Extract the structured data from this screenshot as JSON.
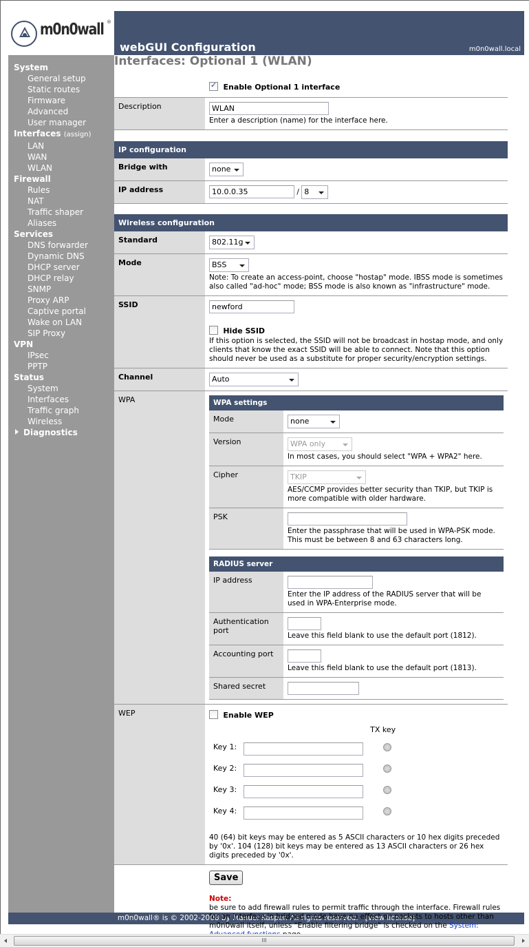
{
  "brand": {
    "logo_text": "m0n0wall",
    "registered": "®"
  },
  "header": {
    "title": "webGUI Configuration",
    "hostname": "m0n0wall.local"
  },
  "sidebar": {
    "groups": [
      {
        "label": "System",
        "items": [
          "General setup",
          "Static routes",
          "Firmware",
          "Advanced",
          "User manager"
        ]
      },
      {
        "label": "Interfaces",
        "extra": "(assign)",
        "items": [
          "LAN",
          "WAN",
          "WLAN"
        ]
      },
      {
        "label": "Firewall",
        "items": [
          "Rules",
          "NAT",
          "Traffic shaper",
          "Aliases"
        ]
      },
      {
        "label": "Services",
        "items": [
          "DNS forwarder",
          "Dynamic DNS",
          "DHCP server",
          "DHCP relay",
          "SNMP",
          "Proxy ARP",
          "Captive portal",
          "Wake on LAN",
          "SIP Proxy"
        ]
      },
      {
        "label": "VPN",
        "items": [
          "IPsec",
          "PPTP"
        ]
      },
      {
        "label": "Status",
        "items": [
          "System",
          "Interfaces",
          "Traffic graph",
          "Wireless"
        ]
      }
    ],
    "collapsed_group": "Diagnostics"
  },
  "page": {
    "title": "Interfaces: Optional 1 (WLAN)",
    "enable_label": "Enable Optional 1 interface",
    "enable_checked": true,
    "description": {
      "label": "Description",
      "value": "WLAN",
      "hint": "Enter a description (name) for the interface here."
    },
    "ip_section": "IP configuration",
    "bridge": {
      "label": "Bridge with",
      "value": "none"
    },
    "ip": {
      "label": "IP address",
      "value": "10.0.0.35",
      "sep": "/",
      "mask": "8"
    },
    "wireless_section": "Wireless configuration",
    "standard": {
      "label": "Standard",
      "value": "802.11g"
    },
    "mode": {
      "label": "Mode",
      "value": "BSS",
      "hint": "Note: To create an access-point, choose \"hostap\" mode. IBSS mode is sometimes also called \"ad-hoc\" mode; BSS mode is also known as \"infrastructure\" mode."
    },
    "ssid": {
      "label": "SSID",
      "value": "newford",
      "hide_label": "Hide SSID",
      "hide_checked": false,
      "hint": "If this option is selected, the SSID will not be broadcast in hostap mode, and only clients that know the exact SSID will be able to connect. Note that this option should never be used as a substitute for proper security/encryption settings."
    },
    "channel": {
      "label": "Channel",
      "value": "Auto"
    },
    "wpa": {
      "label": "WPA",
      "section": "WPA settings",
      "mode": {
        "label": "Mode",
        "value": "none"
      },
      "version": {
        "label": "Version",
        "value": "WPA only",
        "hint": "In most cases, you should select \"WPA + WPA2\" here."
      },
      "cipher": {
        "label": "Cipher",
        "value": "TKIP",
        "hint": "AES/CCMP provides better security than TKIP, but TKIP is more compatible with older hardware."
      },
      "psk": {
        "label": "PSK",
        "value": "",
        "hint": "Enter the passphrase that will be used in WPA-PSK mode. This must be between 8 and 63 characters long."
      },
      "radius_section": "RADIUS server",
      "radius_ip": {
        "label": "IP address",
        "value": "",
        "hint": "Enter the IP address of the RADIUS server that will be used in WPA-Enterprise mode."
      },
      "auth_port": {
        "label": "Authentication port",
        "value": "",
        "hint": "Leave this field blank to use the default port (1812)."
      },
      "acct_port": {
        "label": "Accounting port",
        "value": "",
        "hint": "Leave this field blank to use the default port (1813)."
      },
      "secret": {
        "label": "Shared secret",
        "value": ""
      }
    },
    "wep": {
      "label": "WEP",
      "enable_label": "Enable WEP",
      "enable_checked": false,
      "txkey_header": "TX key",
      "keys": [
        {
          "label": "Key 1:",
          "value": ""
        },
        {
          "label": "Key 2:",
          "value": ""
        },
        {
          "label": "Key 3:",
          "value": ""
        },
        {
          "label": "Key 4:",
          "value": ""
        }
      ],
      "hint": "40 (64) bit keys may be entered as 5 ASCII characters or 10 hex digits preceded by '0x'. 104 (128) bit keys may be entered as 13 ASCII characters or 26 hex digits preceded by '0x'."
    },
    "save_label": "Save",
    "note_head": "Note:",
    "note_text": "be sure to add firewall rules to permit traffic through the interface. Firewall rules for an interface in bridged mode have no effect on packets to hosts other than m0n0wall itself, unless \"Enable filtering bridge\" is checked on the ",
    "note_link": "System: Advanced functions",
    "note_tail": " page."
  },
  "footer": {
    "text": "m0n0wall® is © 2002-2008 by Manuel Kasper. All rights reserved.",
    "license_link": "[view license]"
  },
  "scrollbar": {
    "grip": "III"
  }
}
